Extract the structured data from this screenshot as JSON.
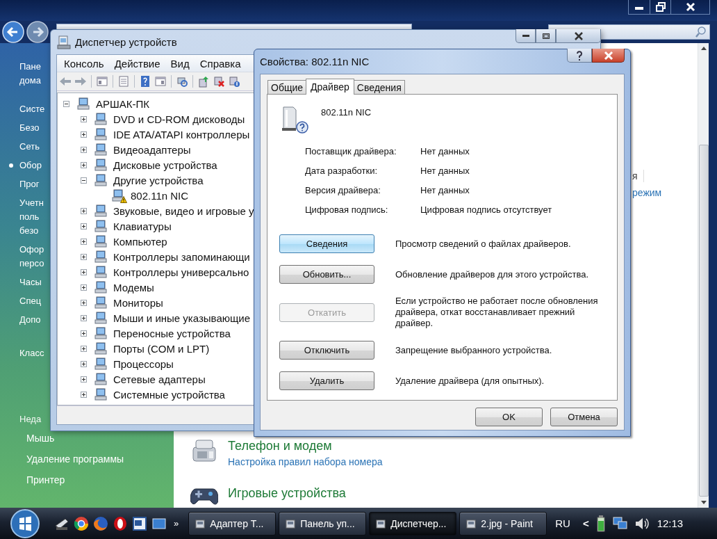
{
  "control_panel": {
    "sidebar": {
      "home": [
        "Пане",
        "дома"
      ],
      "items": [
        {
          "lines": [
            "Систе"
          ],
          "selected": false
        },
        {
          "lines": [
            "Безо"
          ],
          "selected": false
        },
        {
          "lines": [
            "Сеть"
          ],
          "selected": false
        },
        {
          "lines": [
            "Обор"
          ],
          "selected": true
        },
        {
          "lines": [
            "Прог"
          ],
          "selected": false
        },
        {
          "lines": [
            "Учетн",
            "поль",
            "безо"
          ],
          "selected": false
        },
        {
          "lines": [
            "Офор",
            "персо"
          ],
          "selected": false
        },
        {
          "lines": [
            "Часы"
          ],
          "selected": false
        },
        {
          "lines": [
            "Спец"
          ],
          "selected": false
        },
        {
          "lines": [
            "Допо"
          ],
          "selected": false
        }
      ],
      "classic": "Класс",
      "see_also": {
        "title": "Неда",
        "items": [
          "Мышь",
          "Удаление программы",
          "Принтер"
        ]
      }
    },
    "content": {
      "fragments": [
        {
          "kind": "title",
          "text": "я"
        },
        {
          "kind": "link",
          "text": "режим"
        }
      ],
      "sections": [
        {
          "kind": "phone",
          "title": "Телефон и модем",
          "links": [
            "Настройка правил набора номера"
          ]
        },
        {
          "kind": "gamepad",
          "title": "Игровые устройства"
        }
      ]
    }
  },
  "device_manager": {
    "title": "Диспетчер устройств",
    "menu": [
      "Консоль",
      "Действие",
      "Вид",
      "Справка"
    ],
    "tree": {
      "label": "АРШАК-ПК",
      "expanded": true,
      "children": [
        {
          "label": "DVD и CD-ROM дисководы",
          "expanded": false
        },
        {
          "label": "IDE ATA/ATAPI контроллеры",
          "expanded": false
        },
        {
          "label": "Видеоадаптеры",
          "expanded": false
        },
        {
          "label": "Дисковые устройства",
          "expanded": false
        },
        {
          "label": "Другие устройства",
          "expanded": true,
          "children": [
            {
              "label": "802.11n NIC",
              "warning": true
            }
          ]
        },
        {
          "label": "Звуковые, видео и игровые у",
          "expanded": false
        },
        {
          "label": "Клавиатуры",
          "expanded": false
        },
        {
          "label": "Компьютер",
          "expanded": false
        },
        {
          "label": "Контроллеры запоминающи",
          "expanded": false
        },
        {
          "label": "Контроллеры универсально",
          "expanded": false
        },
        {
          "label": "Модемы",
          "expanded": false
        },
        {
          "label": "Мониторы",
          "expanded": false
        },
        {
          "label": "Мыши и иные указывающие",
          "expanded": false
        },
        {
          "label": "Переносные устройства",
          "expanded": false
        },
        {
          "label": "Порты (COM и LPT)",
          "expanded": false
        },
        {
          "label": "Процессоры",
          "expanded": false
        },
        {
          "label": "Сетевые адаптеры",
          "expanded": false
        },
        {
          "label": "Системные устройства",
          "expanded": false
        }
      ]
    }
  },
  "dialog": {
    "title": "Свойства: 802.11n NIC",
    "tabs": [
      {
        "label": "Общие",
        "selected": false
      },
      {
        "label": "Драйвер",
        "selected": true
      },
      {
        "label": "Сведения",
        "selected": false
      }
    ],
    "device_name": "802.11n NIC",
    "info": [
      {
        "label": "Поставщик драйвера:",
        "value": "Нет данных"
      },
      {
        "label": "Дата разработки:",
        "value": "Нет данных"
      },
      {
        "label": "Версия драйвера:",
        "value": "Нет данных"
      },
      {
        "label": "Цифровая подпись:",
        "value": "Цифровая подпись отсутствует"
      }
    ],
    "actions": [
      {
        "label": "Сведения",
        "description": "Просмотр сведений о файлах драйверов.",
        "disabled": false,
        "focused": true
      },
      {
        "label": "Обновить...",
        "description": "Обновление драйверов для этого устройства.",
        "disabled": false,
        "focused": false
      },
      {
        "label": "Откатить",
        "description": "Если устройство не работает после обновления драйвера, откат восстанавливает прежний драйвер.",
        "disabled": true,
        "focused": false
      },
      {
        "label": "Отключить",
        "description": "Запрещение выбранного устройства.",
        "disabled": false,
        "focused": false
      },
      {
        "label": "Удалить",
        "description": "Удаление драйвера (для опытных).",
        "disabled": false,
        "focused": false
      }
    ],
    "buttons": [
      "OK",
      "Отмена"
    ]
  },
  "taskbar": {
    "overflow": "»",
    "tasks": [
      {
        "label": "Адаптер Т...",
        "selected": false
      },
      {
        "label": "Панель уп...",
        "selected": false
      },
      {
        "label": "Диспетчер...",
        "selected": true
      },
      {
        "label": "2.jpg - Paint",
        "selected": false
      }
    ],
    "language": "RU",
    "tray_toggle": "<",
    "clock": "12:13"
  }
}
